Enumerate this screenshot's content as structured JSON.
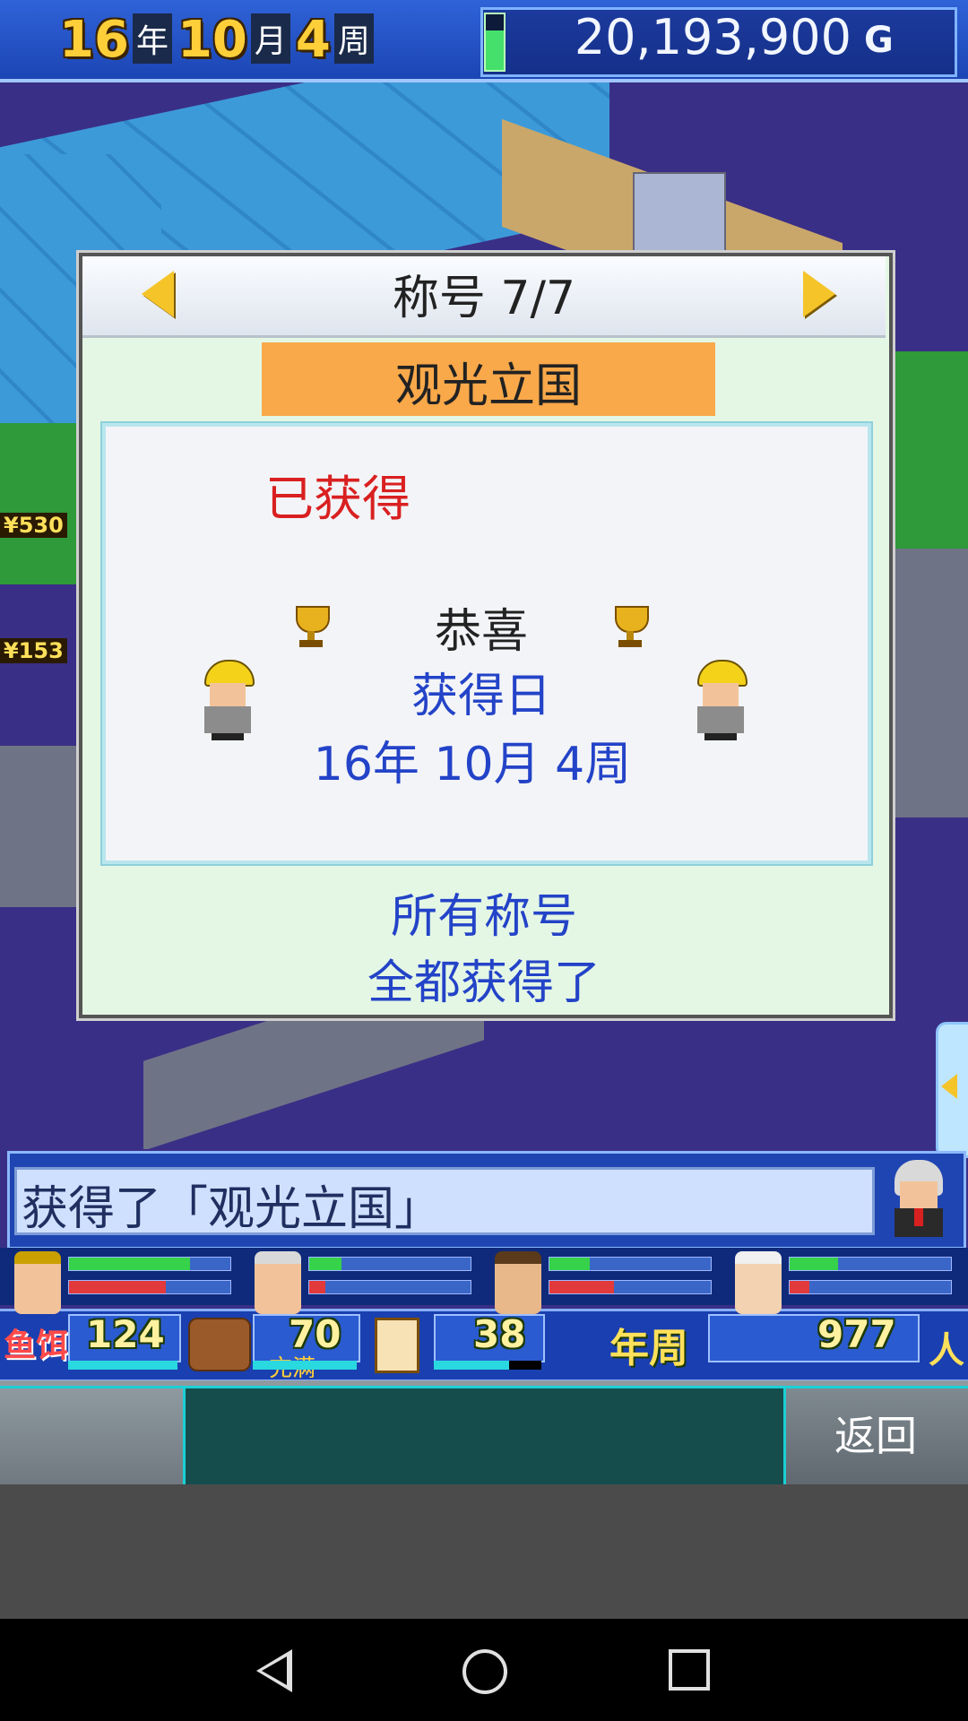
{
  "hud": {
    "year_num": "16",
    "year_unit": "年",
    "month_num": "10",
    "month_unit": "月",
    "week_num": "4",
    "week_unit": "周",
    "money": "20,193,900",
    "money_unit": "G"
  },
  "map_labels": {
    "price_1": "¥530",
    "price_2": "¥153"
  },
  "dialog": {
    "title": "称号 7/7",
    "award_name": "观光立国",
    "status": "已获得",
    "congrats": "恭喜",
    "date_label": "获得日",
    "date_value": "16年 10月 4周",
    "footer_line1": "所有称号",
    "footer_line2": "全都获得了"
  },
  "message": {
    "text": "获得了「观光立国」"
  },
  "stats": {
    "left_label": "鱼饵",
    "value_1": "124",
    "value_2": "70",
    "sub_text": "充满",
    "value_3": "38",
    "year_label": "年周",
    "value_4": "977",
    "person_unit": "人"
  },
  "controls": {
    "back_label": "返回"
  },
  "staff": [
    {
      "green": 0.75,
      "red": 0.6
    },
    {
      "green": 0.2,
      "red": 0.1
    },
    {
      "green": 0.25,
      "red": 0.4
    },
    {
      "green": 0.3,
      "red": 0.12
    }
  ],
  "colors": {
    "accent_gold": "#f5c429",
    "award_tag": "#f9a84a",
    "status_red": "#d92020",
    "info_blue": "#2343c8"
  }
}
